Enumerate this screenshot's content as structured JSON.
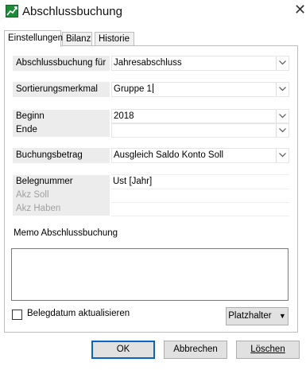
{
  "window": {
    "title": "Abschlussbuchung",
    "icon": "chart-icon",
    "close": "✕"
  },
  "tabs": [
    {
      "label": "Einstellungen",
      "active": true
    },
    {
      "label": "Bilanz",
      "active": false
    },
    {
      "label": "Historie",
      "active": false
    }
  ],
  "fields": {
    "abschluss": {
      "label": "Abschlussbuchung für",
      "value": "Jahresabschluss"
    },
    "sortierung": {
      "label": "Sortierungsmerkmal",
      "value": "Gruppe 1"
    },
    "beginn": {
      "label": "Beginn",
      "value": "2018"
    },
    "ende": {
      "label": "Ende",
      "value": ""
    },
    "betrag": {
      "label": "Buchungsbetrag",
      "value": "Ausgleich Saldo Konto Soll"
    },
    "belegnummer": {
      "label": "Belegnummer",
      "value": "Ust [Jahr]"
    },
    "akz_soll": {
      "label": "Akz Soll",
      "value": ""
    },
    "akz_haben": {
      "label": "Akz Haben",
      "value": ""
    }
  },
  "memo": {
    "label": "Memo Abschlussbuchung",
    "value": ""
  },
  "belegdatum": {
    "label": "Belegdatum aktualisieren",
    "checked": false
  },
  "buttons": {
    "platzhalter": "Platzhalter",
    "platzhalter_arrow": "▼",
    "ok": "OK",
    "abbrechen": "Abbrechen",
    "loeschen": "Löschen"
  },
  "colors": {
    "accent": "#0a64c8",
    "label_bg": "#ececec",
    "icon_green": "#1f8a3a"
  }
}
